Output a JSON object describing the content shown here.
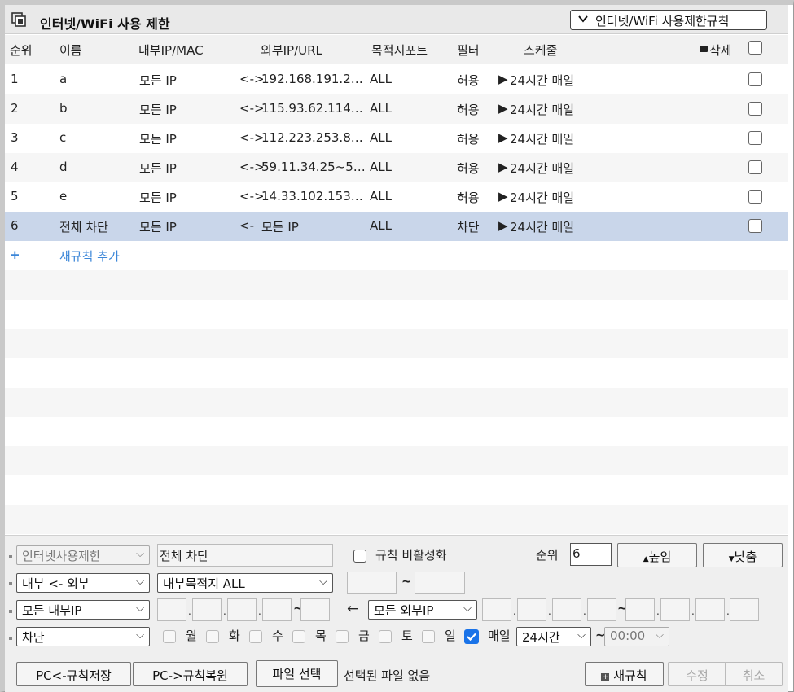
{
  "title": "인터넷/WiFi 사용 제한",
  "rules_dropdown": "인터넷/WiFi 사용제한규칙",
  "headers": {
    "order": "순위",
    "name": "이름",
    "internal": "내부IP/MAC",
    "external": "외부IP/URL",
    "port": "목적지포트",
    "filter": "필터",
    "schedule": "스케줄",
    "delete": "삭제"
  },
  "rows": [
    {
      "order": "1",
      "name": "a",
      "internal": "모든 IP",
      "arrow": "<->",
      "external": "192.168.191.2…",
      "port": "ALL",
      "filter": "허용",
      "schedule": "24시간 매일"
    },
    {
      "order": "2",
      "name": "b",
      "internal": "모든 IP",
      "arrow": "<->",
      "external": "115.93.62.114…",
      "port": "ALL",
      "filter": "허용",
      "schedule": "24시간 매일"
    },
    {
      "order": "3",
      "name": "c",
      "internal": "모든 IP",
      "arrow": "<->",
      "external": "112.223.253.8…",
      "port": "ALL",
      "filter": "허용",
      "schedule": "24시간 매일"
    },
    {
      "order": "4",
      "name": "d",
      "internal": "모든 IP",
      "arrow": "<->",
      "external": "59.11.34.25~5…",
      "port": "ALL",
      "filter": "허용",
      "schedule": "24시간 매일"
    },
    {
      "order": "5",
      "name": "e",
      "internal": "모든 IP",
      "arrow": "<->",
      "external": "14.33.102.153…",
      "port": "ALL",
      "filter": "허용",
      "schedule": "24시간 매일"
    },
    {
      "order": "6",
      "name": "전체 차단",
      "internal": "모든 IP",
      "arrow": "<-",
      "external": "모든 IP",
      "port": "ALL",
      "filter": "차단",
      "schedule": "24시간 매일"
    }
  ],
  "add_rule": "새규칙 추가",
  "form": {
    "category_select": "인터넷사용제한",
    "rule_name": "전체 차단",
    "disable_label": "규칙 비활성화",
    "order_label": "순위",
    "order_value": "6",
    "up_button": "높임",
    "down_button": "낮춤",
    "direction_select": "내부 <- 외부",
    "dest_select": "내부목적지 ALL",
    "tilde": "~",
    "internal_ip_select": "모든 내부IP",
    "arrow_left": "←",
    "external_ip_select": "모든 외부IP",
    "action_select": "차단",
    "days": [
      "월",
      "화",
      "수",
      "목",
      "금",
      "토",
      "일"
    ],
    "everyday_label": "매일",
    "time_select": "24시간",
    "start_time_select": "00:00",
    "save_button": "PC<-규칙저장",
    "restore_button": "PC->규칙복원",
    "file_button": "파일 선택",
    "file_status": "선택된 파일 없음",
    "new_rule_button": "새규칙",
    "modify_button": "수정",
    "cancel_button": "취소"
  },
  "colors": {
    "selected_row": "#c9d6ea",
    "link": "#3b86d8",
    "checkbox_on": "#1a73e8"
  }
}
